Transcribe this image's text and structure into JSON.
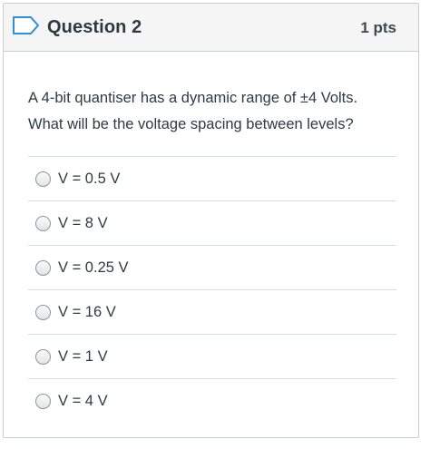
{
  "question": {
    "title": "Question 2",
    "points": "1 pts",
    "text": "A 4-bit quantiser has a dynamic range of ±4 Volts. What will be the voltage spacing between levels?",
    "answers": [
      {
        "label": "V = 0.5 V"
      },
      {
        "label": "V = 8 V"
      },
      {
        "label": "V = 0.25 V"
      },
      {
        "label": "V = 16 V"
      },
      {
        "label": "V = 1 V"
      },
      {
        "label": "V = 4 V"
      }
    ]
  },
  "icons": {
    "flag": "flag-question-icon",
    "radio": "radio-unchecked-icon"
  },
  "colors": {
    "header_bg": "#f5f5f5",
    "border": "#c7cdd1",
    "flag_stroke": "#2d8fd5",
    "text": "#2d3b45"
  }
}
